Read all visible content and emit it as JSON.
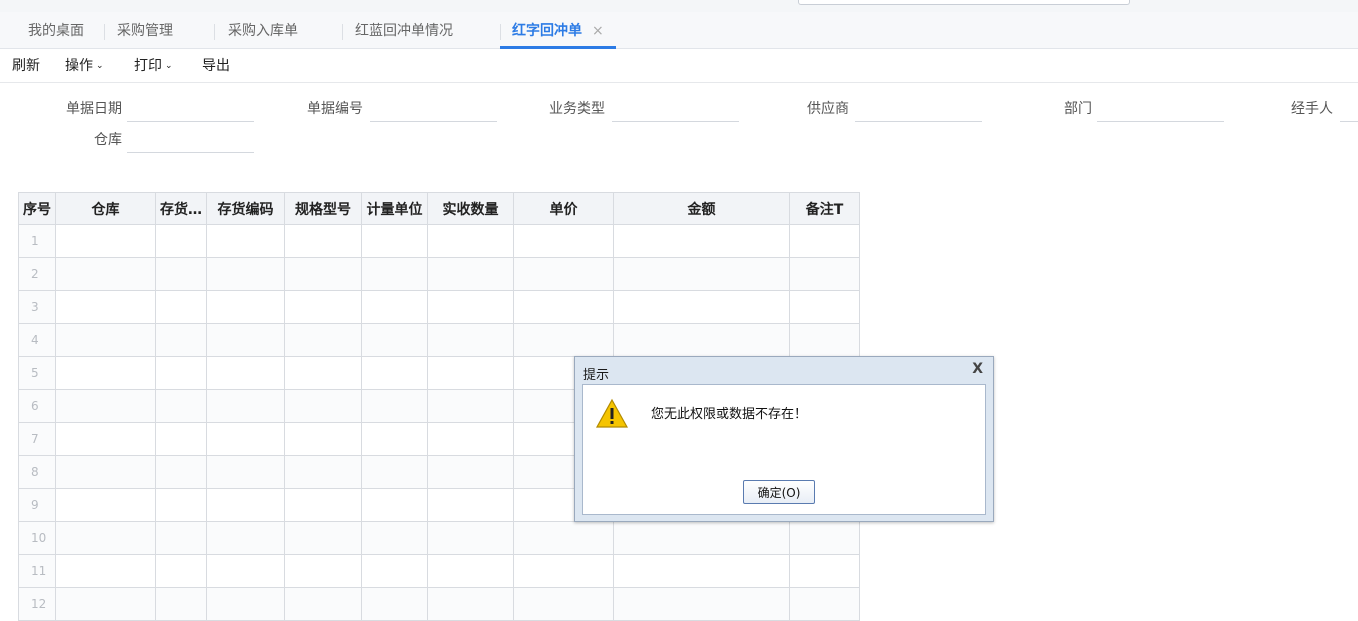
{
  "tabs": [
    {
      "label": "我的桌面"
    },
    {
      "label": "采购管理"
    },
    {
      "label": "采购入库单"
    },
    {
      "label": "红蓝回冲单情况"
    },
    {
      "label": "红字回冲单",
      "active": true,
      "close": "×"
    }
  ],
  "toolbar": {
    "refresh": "刷新",
    "operate": "操作",
    "print": "打印",
    "export": "导出",
    "caret": "⌄"
  },
  "form": {
    "doc_date": "单据日期",
    "doc_no": "单据编号",
    "biz_type": "业务类型",
    "supplier": "供应商",
    "dept": "部门",
    "handler": "经手人",
    "warehouse": "仓库"
  },
  "grid": {
    "headers": [
      "序号",
      "仓库",
      "存货…",
      "存货编码",
      "规格型号",
      "计量单位",
      "实收数量",
      "单价",
      "金额",
      "备注T"
    ],
    "row_numbers": [
      "1",
      "2",
      "3",
      "4",
      "5",
      "6",
      "7",
      "8",
      "9",
      "10",
      "11",
      "12"
    ]
  },
  "dialog": {
    "title": "提示",
    "close": "X",
    "message": "您无此权限或数据不存在！",
    "ok_label": "确定(O)",
    "icon": "warning-icon"
  },
  "colors": {
    "accent": "#2c7be5",
    "dialog_frame": "#dce6f1",
    "warning": "#f5c400"
  }
}
